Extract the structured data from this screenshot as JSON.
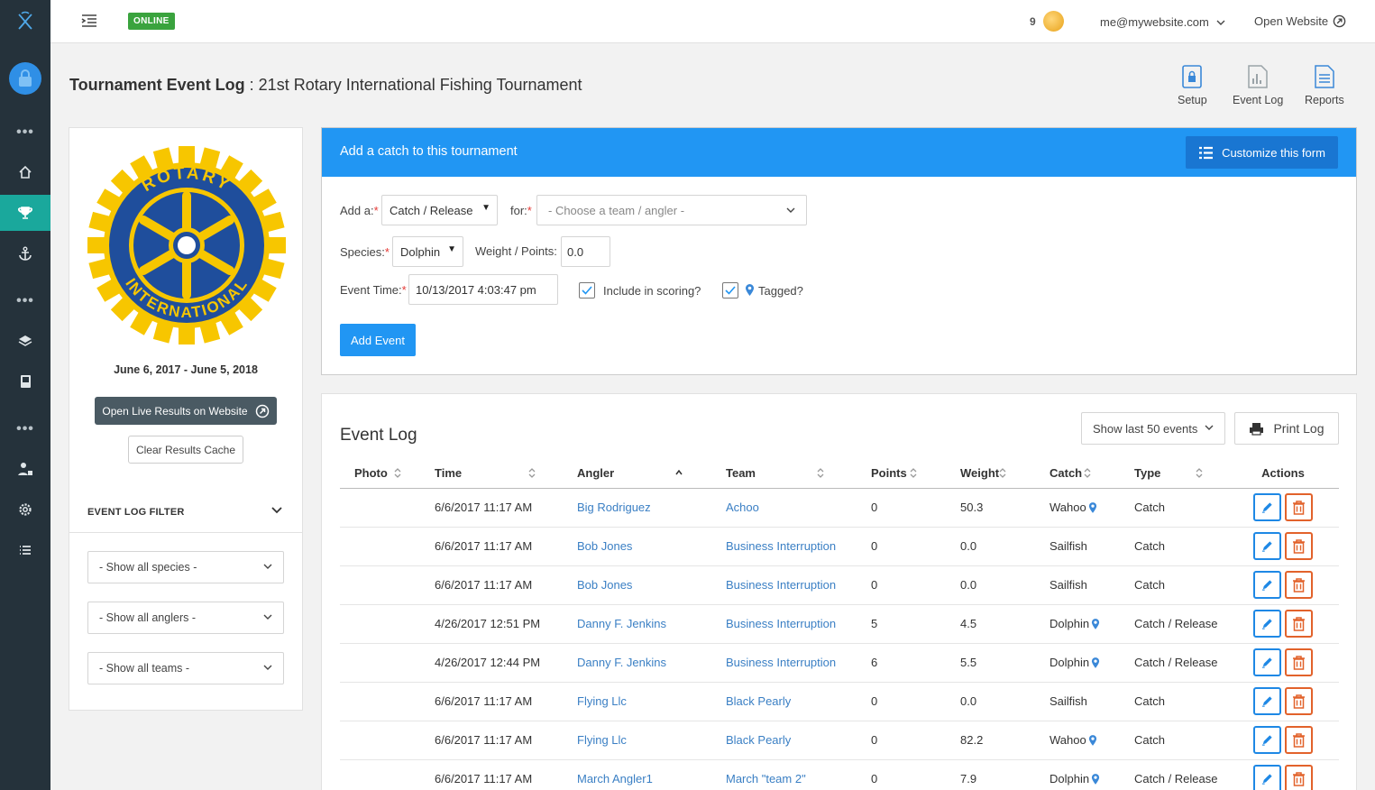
{
  "topbar": {
    "status": "ONLINE",
    "coin_count": "9",
    "user_email": "me@mywebsite.com",
    "open_website": "Open Website"
  },
  "header": {
    "title_bold": "Tournament Event Log",
    "title_rest": " : 21st Rotary International Fishing Tournament",
    "quick_nav": [
      {
        "label": "Setup",
        "icon": "clipboard-lock-icon"
      },
      {
        "label": "Event Log",
        "icon": "bar-chart-doc-icon"
      },
      {
        "label": "Reports",
        "icon": "document-icon"
      }
    ]
  },
  "left_panel": {
    "logo_ring_text_top": "ROTARY",
    "logo_ring_text_bottom": "INTERNATIONAL",
    "dates": "June 6, 2017 - June 5, 2018",
    "live_results_button": "Open Live Results on Website",
    "clear_cache_button": "Clear Results Cache",
    "filter_title": "EVENT LOG FILTER",
    "filters": [
      "- Show all species -",
      "- Show all anglers -",
      "- Show all teams -"
    ]
  },
  "catch_form": {
    "title": "Add a catch to this tournament",
    "customize_label": "Customize this form",
    "add_a_label": "Add a:",
    "add_a_value": "Catch / Release",
    "for_label": "for:",
    "for_placeholder": "- Choose a team / angler -",
    "species_label": "Species:",
    "species_value": "Dolphin",
    "weight_label": "Weight / Points:",
    "weight_value": "0.0",
    "event_time_label": "Event Time:",
    "event_time_value": "10/13/2017 4:03:47 pm",
    "include_scoring_label": "Include in scoring?",
    "tagged_label": "Tagged?",
    "include_scoring_checked": true,
    "tagged_checked": true,
    "add_button": "Add Event"
  },
  "event_log": {
    "title": "Event Log",
    "show_last": "Show last 50 events",
    "print_button": "Print Log",
    "columns": [
      "Photo",
      "Time",
      "Angler",
      "Team",
      "Points",
      "Weight",
      "Catch",
      "Type",
      "Actions"
    ],
    "rows": [
      {
        "time": "6/6/2017 11:17 AM",
        "angler": "Big Rodriguez",
        "team": "Achoo",
        "points": "0",
        "weight": "50.3",
        "catch": "Wahoo",
        "tagged": true,
        "type": "Catch"
      },
      {
        "time": "6/6/2017 11:17 AM",
        "angler": "Bob Jones",
        "team": "Business Interruption",
        "points": "0",
        "weight": "0.0",
        "catch": "Sailfish",
        "tagged": false,
        "type": "Catch"
      },
      {
        "time": "6/6/2017 11:17 AM",
        "angler": "Bob Jones",
        "team": "Business Interruption",
        "points": "0",
        "weight": "0.0",
        "catch": "Sailfish",
        "tagged": false,
        "type": "Catch"
      },
      {
        "time": "4/26/2017 12:51 PM",
        "angler": "Danny F. Jenkins",
        "team": "Business Interruption",
        "points": "5",
        "weight": "4.5",
        "catch": "Dolphin",
        "tagged": true,
        "type": "Catch / Release"
      },
      {
        "time": "4/26/2017 12:44 PM",
        "angler": "Danny F. Jenkins",
        "team": "Business Interruption",
        "points": "6",
        "weight": "5.5",
        "catch": "Dolphin",
        "tagged": true,
        "type": "Catch / Release"
      },
      {
        "time": "6/6/2017 11:17 AM",
        "angler": "Flying Llc",
        "team": "Black Pearly",
        "points": "0",
        "weight": "0.0",
        "catch": "Sailfish",
        "tagged": false,
        "type": "Catch"
      },
      {
        "time": "6/6/2017 11:17 AM",
        "angler": "Flying Llc",
        "team": "Black Pearly",
        "points": "0",
        "weight": "82.2",
        "catch": "Wahoo",
        "tagged": true,
        "type": "Catch"
      },
      {
        "time": "6/6/2017 11:17 AM",
        "angler": "March Angler1",
        "team": "March \"team 2\"",
        "points": "0",
        "weight": "7.9",
        "catch": "Dolphin",
        "tagged": true,
        "type": "Catch / Release"
      }
    ]
  },
  "colors": {
    "sidebar": "#25323b",
    "active_nav": "#1aa89c",
    "primary": "#2196f3",
    "link": "#3a7fc4",
    "delete": "#e2622b",
    "online": "#3aa33e",
    "rotary_gold": "#f7c600",
    "rotary_blue": "#1f4e9c"
  }
}
